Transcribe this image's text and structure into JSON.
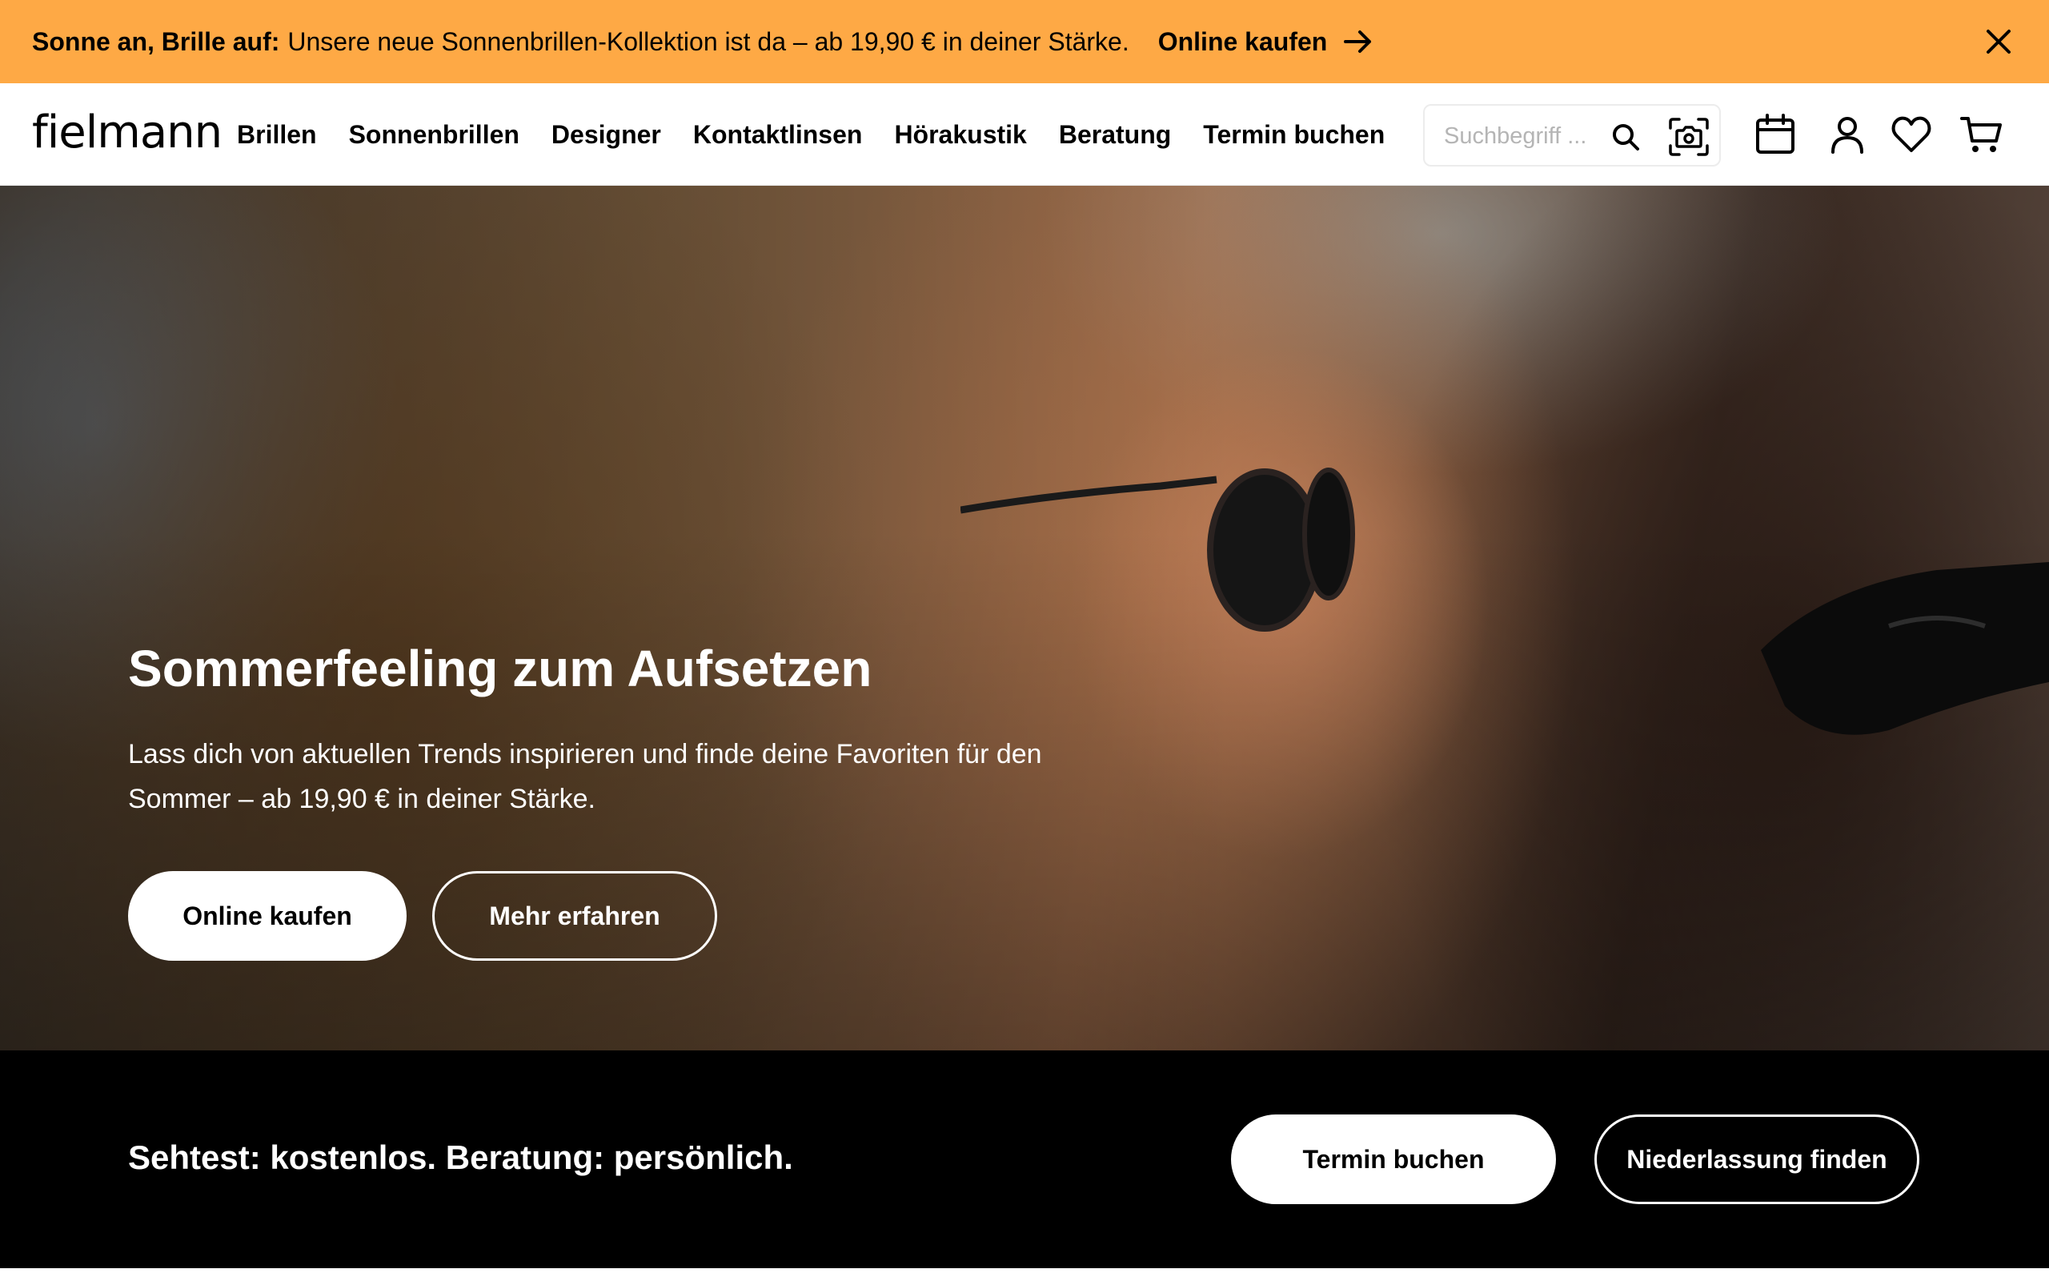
{
  "promo": {
    "bold": "Sonne an, Brille auf:",
    "text": "Unsere neue Sonnenbrillen-Kollektion ist da – ab 19,90 € in deiner Stärke.",
    "link_label": "Online kaufen",
    "icons": {
      "arrow": "arrow-right-icon",
      "close": "close-icon"
    },
    "background": "#FEA945"
  },
  "header": {
    "logo": "fielmann",
    "nav": [
      "Brillen",
      "Sonnenbrillen",
      "Designer",
      "Kontaktlinsen",
      "Hörakustik",
      "Beratung",
      "Termin buchen"
    ],
    "search": {
      "placeholder": "Suchbegriff ...",
      "value": ""
    },
    "icons": [
      "search-icon",
      "camera-search-icon",
      "calendar-icon",
      "account-icon",
      "wishlist-heart-icon",
      "cart-icon"
    ]
  },
  "hero": {
    "title": "Sommerfeeling zum Aufsetzen",
    "subtitle": "Lass dich von aktuellen Trends inspirieren und finde deine Favoriten für den Sommer – ab 19,90 € in deiner Stärke.",
    "primary_button": "Online kaufen",
    "secondary_button": "Mehr erfahren"
  },
  "infobar": {
    "text": "Sehtest: kostenlos. Beratung: persönlich.",
    "primary_button": "Termin buchen",
    "secondary_button": "Niederlassung finden",
    "background": "#000000"
  }
}
